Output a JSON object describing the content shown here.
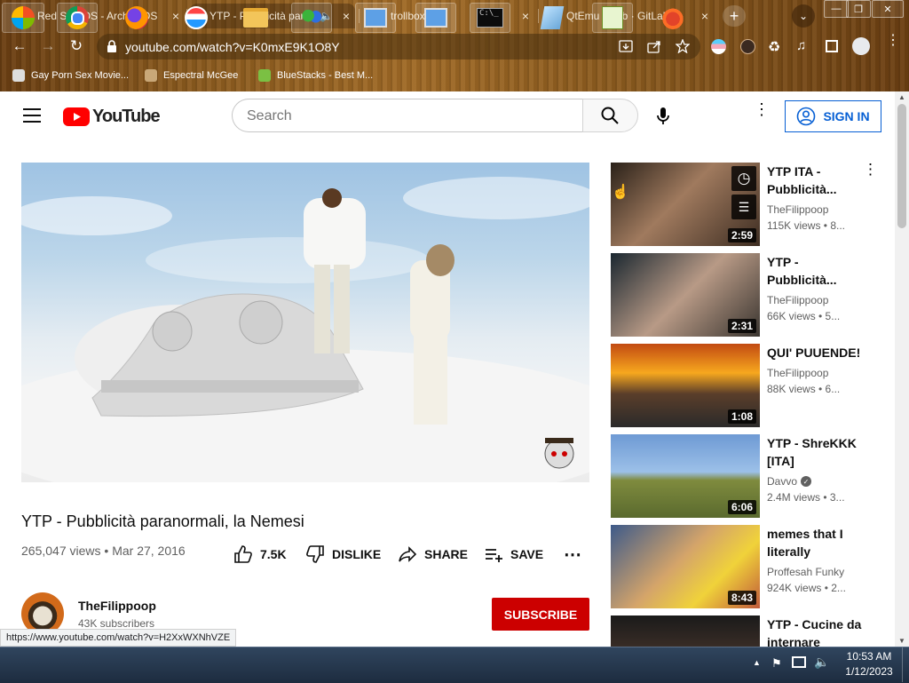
{
  "browser": {
    "tabs": [
      {
        "title": "Red Star OS - ArchiveOS",
        "close": "×"
      },
      {
        "title": "YTP - Pubblicità paran",
        "close": "×"
      },
      {
        "title": "trollbox (6)",
        "close": "×"
      },
      {
        "title": "QtEmu / web · GitLab",
        "close": "×"
      }
    ],
    "new_tab": "+",
    "url": "youtube.com/watch?v=K0mxE9K1O8Y",
    "bookmarks": [
      "Gay Porn Sex Movie...",
      "Espectral McGee",
      "BlueStacks - Best M..."
    ],
    "status_url": "https://www.youtube.com/watch?v=H2XxWXNhVZE"
  },
  "youtube": {
    "logo_text": "YouTube",
    "search_placeholder": "Search",
    "sign_in": "SIGN IN"
  },
  "video": {
    "title": "YTP - Pubblicità paranormali, la Nemesi",
    "views": "265,047 views",
    "date": "Mar 27, 2016",
    "likes": "7.5K",
    "dislike_label": "DISLIKE",
    "share_label": "SHARE",
    "save_label": "SAVE",
    "channel": "TheFilippoop",
    "subscribers": "43K subscribers",
    "subscribe_label": "SUBSCRIBE"
  },
  "recommendations": [
    {
      "title_lines": [
        "YTP ITA -",
        "Pubblicità..."
      ],
      "channel": "TheFilippoop",
      "views": "115K views • 8...",
      "duration": "2:59",
      "verified": false
    },
    {
      "title_lines": [
        "YTP -",
        "Pubblicità..."
      ],
      "channel": "TheFilippoop",
      "views": "66K views • 5...",
      "duration": "2:31",
      "verified": false
    },
    {
      "title_lines": [
        "QUI' PUUENDE!"
      ],
      "channel": "TheFilippoop",
      "views": "88K views • 6...",
      "duration": "1:08",
      "verified": false
    },
    {
      "title_lines": [
        "YTP - ShreKKK",
        "[ITA]"
      ],
      "channel": "Davvo",
      "views": "2.4M views • 3...",
      "duration": "6:06",
      "verified": true
    },
    {
      "title_lines": [
        "memes that I",
        "literally"
      ],
      "channel": "Proffesah Funky",
      "views": "924K views • 2...",
      "duration": "8:43",
      "verified": false
    },
    {
      "title_lines": [
        "YTP - Cucine da",
        "internare"
      ],
      "channel": "",
      "views": "",
      "duration": "",
      "verified": false
    }
  ],
  "taskbar": {
    "time": "10:53 AM",
    "date": "1/12/2023"
  },
  "colors": {
    "youtube_red": "#ff0000",
    "subscribe_red": "#cc0000",
    "link_blue": "#065fd4"
  }
}
